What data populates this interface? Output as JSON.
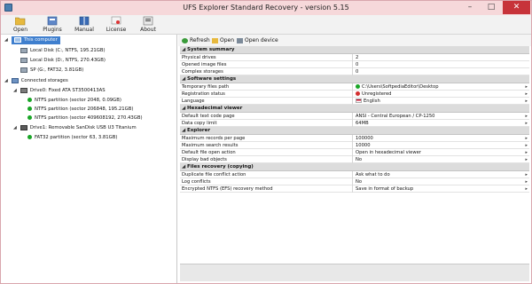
{
  "window": {
    "title": "UFS Explorer Standard Recovery - version 5.15"
  },
  "toolbar": {
    "open": "Open",
    "plugins": "Plugins",
    "manual": "Manual",
    "license": "License",
    "about": "About"
  },
  "tree": {
    "this_computer": "This computer",
    "local_c": "Local Disk (C:, NTFS, 195.21GB)",
    "local_d": "Local Disk (D:, NTFS, 270.43GB)",
    "sp_g": "SP (G:, FAT32, 3.81GB)",
    "connected": "Connected storages",
    "drive0": "Drive0: Fixed ATA ST3500413AS",
    "ntfs1": "NTFS partition (sector 2048, 0.09GB)",
    "ntfs2": "NTFS partition (sector 206848, 195.21GB)",
    "ntfs3": "NTFS partition (sector 409608192, 270.43GB)",
    "drive1": "Drive1: Removable SanDisk USB U3 Titanium",
    "fat32": "FAT32 partition (sector 63, 3.81GB)"
  },
  "panel_toolbar": {
    "refresh": "Refresh",
    "open": "Open",
    "open_device": "Open device"
  },
  "sections": {
    "system_summary": "System summary",
    "software_settings": "Software settings",
    "hex_viewer": "Hexadecimal viewer",
    "explorer": "Explorer",
    "files_recovery": "Files recovery (copying)"
  },
  "props": {
    "physical_drives": {
      "key": "Physical drives",
      "value": "2"
    },
    "opened_images": {
      "key": "Opened image files",
      "value": "0"
    },
    "complex_storages": {
      "key": "Complex storages",
      "value": "0"
    },
    "temp_path": {
      "key": "Temporary files path",
      "value": "C:\\Users\\SoftpediaEditor\\Desktop"
    },
    "registration": {
      "key": "Registration status",
      "value": "Unregistered"
    },
    "language": {
      "key": "Language",
      "value": "English"
    },
    "code_page": {
      "key": "Default text code page",
      "value": "ANSI - Central European / CP-1250"
    },
    "copy_limit": {
      "key": "Data copy limit",
      "value": "64MB"
    },
    "max_records": {
      "key": "Maximum records per page",
      "value": "100000"
    },
    "max_search": {
      "key": "Maximum search results",
      "value": "10000"
    },
    "open_action": {
      "key": "Default file open action",
      "value": "Open in hexadecimal viewer"
    },
    "bad_objects": {
      "key": "Display bad objects",
      "value": "No"
    },
    "dup_conflict": {
      "key": "Duplicate file conflict action",
      "value": "Ask what to do"
    },
    "log_conflicts": {
      "key": "Log conflicts",
      "value": "No"
    },
    "efs_method": {
      "key": "Encrypted NTFS (EFS) recovery method",
      "value": "Save in format of backup"
    }
  },
  "colors": {
    "accent": "#3f7fce",
    "status_ok": "#19a526",
    "status_bad": "#d32f2f"
  }
}
